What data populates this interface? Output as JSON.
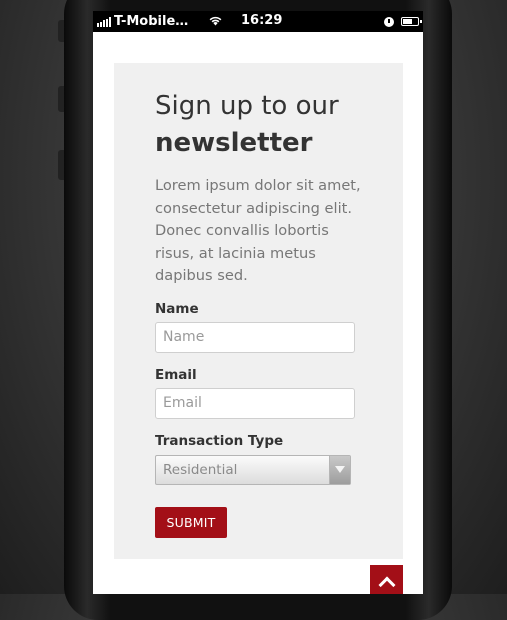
{
  "status_bar": {
    "carrier": "T-Mobile…",
    "time": "16:29",
    "battery_level": 0.7
  },
  "newsletter": {
    "title_line1": "Sign up to our",
    "title_line2": "newsletter",
    "description": "Lorem ipsum dolor sit amet, consectetur adipiscing elit. Donec convallis lobortis risus, at lacinia metus dapibus sed.",
    "name_label": "Name",
    "name_placeholder": "Name",
    "email_label": "Email",
    "email_placeholder": "Email",
    "transaction_label": "Transaction Type",
    "transaction_value": "Residential",
    "submit_label": "SUBMIT"
  },
  "colors": {
    "accent": "#a30f17",
    "card_background": "#f0f0f0"
  },
  "icons": [
    "signal-icon",
    "wifi-icon",
    "clock-icon",
    "battery-icon",
    "chevron-down-icon",
    "chevron-up-icon"
  ]
}
